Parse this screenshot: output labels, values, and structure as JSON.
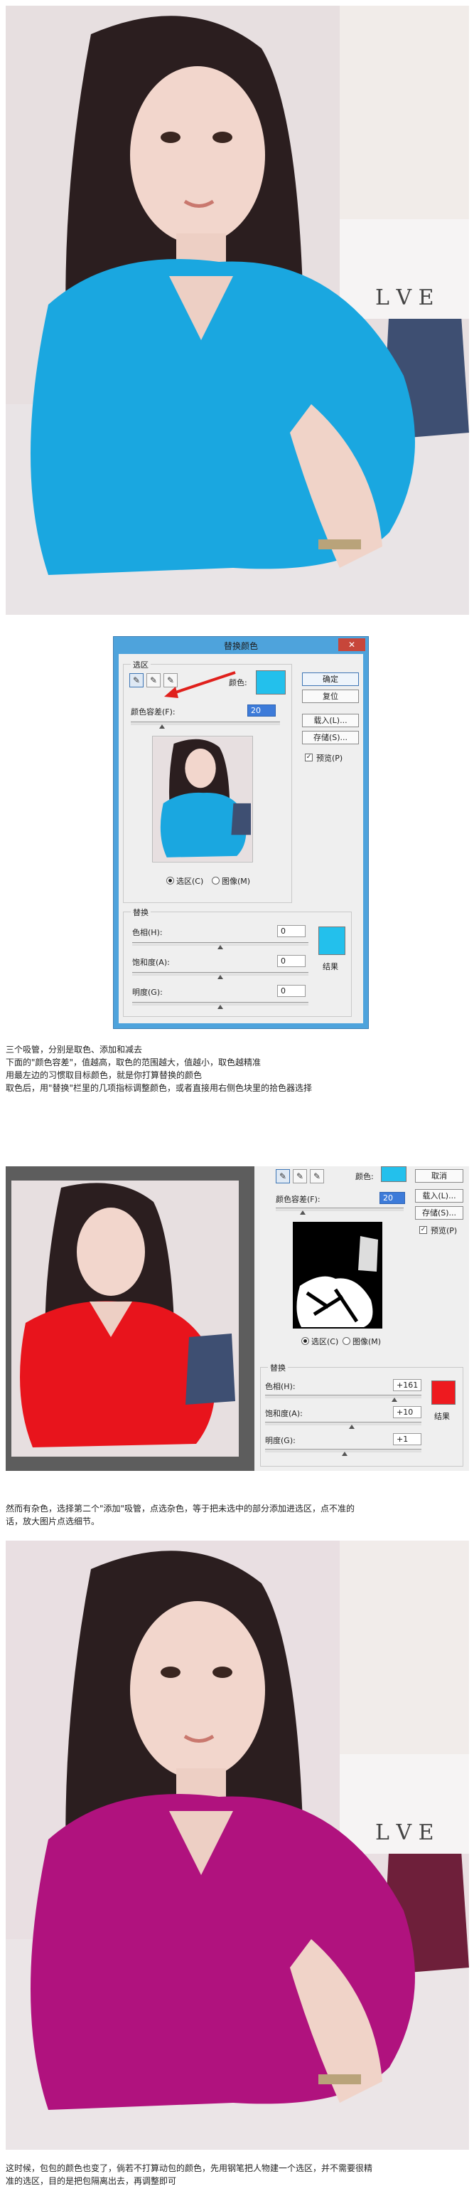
{
  "photo1": {
    "subject": "portrait-blue-sweater",
    "sweater_color": "#1aa7e0"
  },
  "dialog": {
    "title": "替换颜色",
    "close_label": "✕",
    "selection_group": "选区",
    "color_label": "颜色:",
    "swatch_color": "#23c0ec",
    "tolerance_label": "颜色容差(F):",
    "tolerance_value": "20",
    "radio_selection": "选区(C)",
    "radio_image": "图像(M)",
    "buttons": {
      "ok": "确定",
      "reset": "复位",
      "load": "载入(L)...",
      "save": "存储(S)..."
    },
    "preview_label": "预览(P)",
    "replace_group": "替换",
    "hue_label": "色相(H):",
    "hue_value": "0",
    "saturation_label": "饱和度(A):",
    "saturation_value": "0",
    "lightness_label": "明度(G):",
    "lightness_value": "0",
    "result_label": "结果",
    "result_color": "#23c0ec"
  },
  "text1": {
    "lines": [
      "三个吸管，分别是取色、添加和减去",
      "下面的\"颜色容差\"，值越高，取色的范围越大，值越小，取色越精准",
      "用最左边的习惯取目标颜色，就是你打算替换的颜色",
      "取色后，用\"替换\"栏里的几项指标调整颜色，或者直接用右侧色块里的拾色器选择"
    ]
  },
  "screenshot2": {
    "photo_sweater_color": "#e8141c",
    "color_label": "颜色:",
    "swatch_color": "#23c0ec",
    "cancel_button": "取消",
    "load_button": "载入(L)...",
    "save_button": "存储(S)...",
    "preview_label": "预览(P)",
    "tolerance_label": "颜色容差(F):",
    "tolerance_value": "20",
    "radio_selection": "选区(C)",
    "radio_image": "图像(M)",
    "replace_group": "替换",
    "hue_label": "色相(H):",
    "hue_value": "+161",
    "saturation_label": "饱和度(A):",
    "saturation_value": "+10",
    "lightness_label": "明度(G):",
    "lightness_value": "+1",
    "result_label": "结果",
    "result_color": "#ee1a1f"
  },
  "text2": {
    "lines": [
      "然而有杂色，选择第二个\"添加\"吸管，点选杂色，等于把未选中的部分添加进选区，点不准的",
      "话，放大图片点选细节。"
    ]
  },
  "photo3": {
    "subject": "portrait-magenta-sweater",
    "sweater_color": "#b0127e"
  },
  "text3": {
    "lines": [
      "这时候，包包的颜色也变了，倘若不打算动包的颜色，先用钢笔把人物建一个选区，并不需要很精",
      "准的选区，目的是把包隔离出去，再调整即可"
    ]
  }
}
